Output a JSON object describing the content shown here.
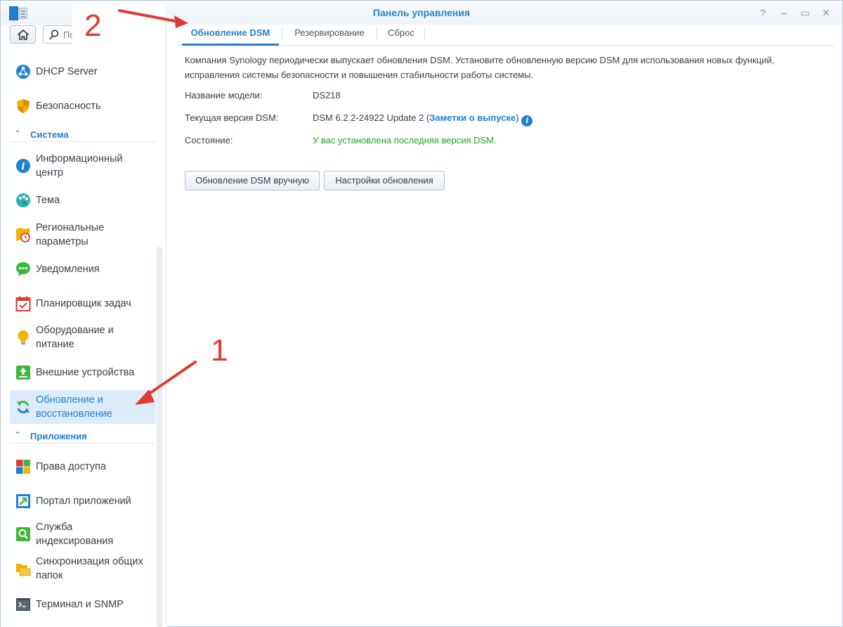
{
  "window": {
    "title": "Панель управления",
    "controls": [
      "?",
      "–",
      "▭",
      "✕"
    ]
  },
  "sidebar": {
    "search_placeholder": "Поиск",
    "items": [
      {
        "label": "DHCP Server",
        "icon": "network-icon"
      },
      {
        "label": "Безопасность",
        "icon": "shield-icon"
      },
      {
        "section": "Система"
      },
      {
        "label": "Информационный центр",
        "icon": "info-icon"
      },
      {
        "label": "Тема",
        "icon": "palette-icon"
      },
      {
        "label": "Региональные параметры",
        "icon": "clock-map-icon"
      },
      {
        "label": "Уведомления",
        "icon": "chat-icon"
      },
      {
        "label": "Планировщик задач",
        "icon": "calendar-icon"
      },
      {
        "label": "Оборудование и питание",
        "icon": "lightbulb-icon"
      },
      {
        "label": "Внешние устройства",
        "icon": "upload-icon"
      },
      {
        "label": "Обновление и восстановление",
        "icon": "refresh-icon",
        "active": true
      },
      {
        "section": "Приложения"
      },
      {
        "label": "Права доступа",
        "icon": "grid-icon"
      },
      {
        "label": "Портал приложений",
        "icon": "portal-icon"
      },
      {
        "label": "Служба индексирования",
        "icon": "search-doc-icon"
      },
      {
        "label": "Синхронизация общих папок",
        "icon": "folder-sync-icon"
      },
      {
        "label": "Терминал и SNMP",
        "icon": "terminal-icon"
      }
    ]
  },
  "tabs": [
    {
      "label": "Обновление DSM",
      "active": true
    },
    {
      "label": "Резервирование"
    },
    {
      "label": "Сброс"
    }
  ],
  "main": {
    "description": "Компания Synology периодически выпускает обновления DSM. Установите обновленную версию DSM для использования новых функций, исправления системы безопасности и повышения стабильности работы системы.",
    "model_label": "Название модели:",
    "model_value": "DS218",
    "version_label": "Текущая версия DSM:",
    "version_value": "DSM 6.2.2-24922 Update 2 (",
    "version_link": "Заметки о выпуске",
    "version_close": ")",
    "status_label": "Состояние:",
    "status_value": "У вас установлена последняя версия DSM.",
    "manual_update_button": "Обновление DSM вручную",
    "update_settings_button": "Настройки обновления"
  },
  "annotations": {
    "label_1": "1",
    "label_2": "2",
    "color": "#e03b32"
  }
}
